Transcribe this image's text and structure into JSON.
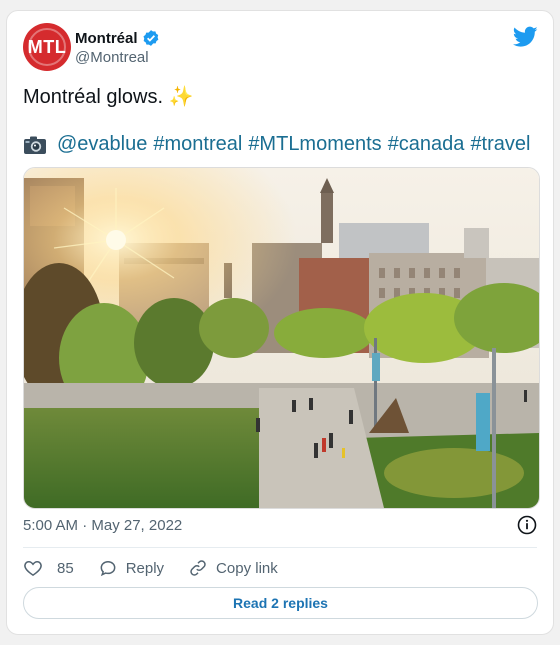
{
  "account": {
    "name": "Montréal",
    "handle": "@Montreal",
    "avatar_text": "MTL",
    "avatar_color": "#d52b2e",
    "verified": true
  },
  "tweet": {
    "text": "Montréal glows.",
    "sparkle": "✨",
    "tags": [
      "@evablue",
      "#montreal",
      "#MTLmoments",
      "#canada",
      "#travel"
    ],
    "link_color": "#1b6e92"
  },
  "meta": {
    "timestamp": "5:00 AM · May 27, 2022"
  },
  "actions": {
    "like_count": "85",
    "reply_label": "Reply",
    "copy_link_label": "Copy link"
  },
  "replies_button": {
    "label": "Read 2 replies"
  },
  "icons": {
    "brand": "twitter-bird-icon",
    "verified": "verified-badge-icon",
    "info": "info-icon",
    "like": "heart-icon",
    "reply": "speech-bubble-icon",
    "copy_link": "link-icon",
    "camera": "camera-icon"
  }
}
